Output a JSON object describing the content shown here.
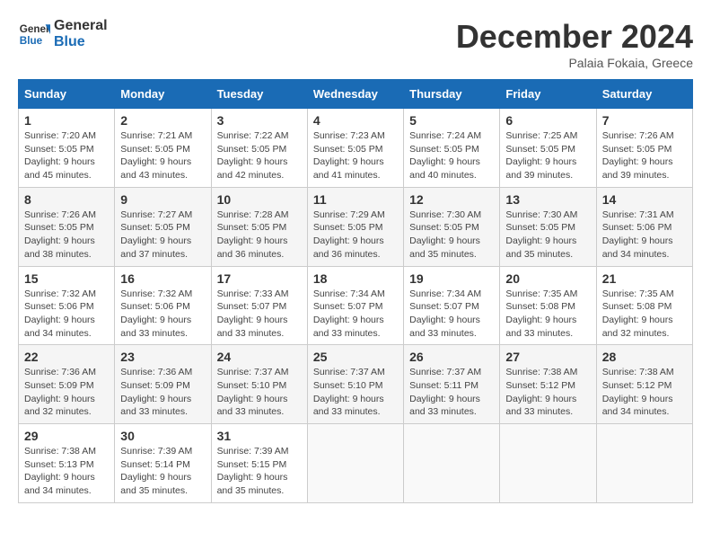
{
  "header": {
    "logo_line1": "General",
    "logo_line2": "Blue",
    "month_title": "December 2024",
    "subtitle": "Palaia Fokaia, Greece"
  },
  "weekdays": [
    "Sunday",
    "Monday",
    "Tuesday",
    "Wednesday",
    "Thursday",
    "Friday",
    "Saturday"
  ],
  "weeks": [
    [
      {
        "day": "1",
        "sunrise": "7:20 AM",
        "sunset": "5:05 PM",
        "daylight": "9 hours and 45 minutes."
      },
      {
        "day": "2",
        "sunrise": "7:21 AM",
        "sunset": "5:05 PM",
        "daylight": "9 hours and 43 minutes."
      },
      {
        "day": "3",
        "sunrise": "7:22 AM",
        "sunset": "5:05 PM",
        "daylight": "9 hours and 42 minutes."
      },
      {
        "day": "4",
        "sunrise": "7:23 AM",
        "sunset": "5:05 PM",
        "daylight": "9 hours and 41 minutes."
      },
      {
        "day": "5",
        "sunrise": "7:24 AM",
        "sunset": "5:05 PM",
        "daylight": "9 hours and 40 minutes."
      },
      {
        "day": "6",
        "sunrise": "7:25 AM",
        "sunset": "5:05 PM",
        "daylight": "9 hours and 39 minutes."
      },
      {
        "day": "7",
        "sunrise": "7:26 AM",
        "sunset": "5:05 PM",
        "daylight": "9 hours and 39 minutes."
      }
    ],
    [
      {
        "day": "8",
        "sunrise": "7:26 AM",
        "sunset": "5:05 PM",
        "daylight": "9 hours and 38 minutes."
      },
      {
        "day": "9",
        "sunrise": "7:27 AM",
        "sunset": "5:05 PM",
        "daylight": "9 hours and 37 minutes."
      },
      {
        "day": "10",
        "sunrise": "7:28 AM",
        "sunset": "5:05 PM",
        "daylight": "9 hours and 36 minutes."
      },
      {
        "day": "11",
        "sunrise": "7:29 AM",
        "sunset": "5:05 PM",
        "daylight": "9 hours and 36 minutes."
      },
      {
        "day": "12",
        "sunrise": "7:30 AM",
        "sunset": "5:05 PM",
        "daylight": "9 hours and 35 minutes."
      },
      {
        "day": "13",
        "sunrise": "7:30 AM",
        "sunset": "5:05 PM",
        "daylight": "9 hours and 35 minutes."
      },
      {
        "day": "14",
        "sunrise": "7:31 AM",
        "sunset": "5:06 PM",
        "daylight": "9 hours and 34 minutes."
      }
    ],
    [
      {
        "day": "15",
        "sunrise": "7:32 AM",
        "sunset": "5:06 PM",
        "daylight": "9 hours and 34 minutes."
      },
      {
        "day": "16",
        "sunrise": "7:32 AM",
        "sunset": "5:06 PM",
        "daylight": "9 hours and 33 minutes."
      },
      {
        "day": "17",
        "sunrise": "7:33 AM",
        "sunset": "5:07 PM",
        "daylight": "9 hours and 33 minutes."
      },
      {
        "day": "18",
        "sunrise": "7:34 AM",
        "sunset": "5:07 PM",
        "daylight": "9 hours and 33 minutes."
      },
      {
        "day": "19",
        "sunrise": "7:34 AM",
        "sunset": "5:07 PM",
        "daylight": "9 hours and 33 minutes."
      },
      {
        "day": "20",
        "sunrise": "7:35 AM",
        "sunset": "5:08 PM",
        "daylight": "9 hours and 33 minutes."
      },
      {
        "day": "21",
        "sunrise": "7:35 AM",
        "sunset": "5:08 PM",
        "daylight": "9 hours and 32 minutes."
      }
    ],
    [
      {
        "day": "22",
        "sunrise": "7:36 AM",
        "sunset": "5:09 PM",
        "daylight": "9 hours and 32 minutes."
      },
      {
        "day": "23",
        "sunrise": "7:36 AM",
        "sunset": "5:09 PM",
        "daylight": "9 hours and 33 minutes."
      },
      {
        "day": "24",
        "sunrise": "7:37 AM",
        "sunset": "5:10 PM",
        "daylight": "9 hours and 33 minutes."
      },
      {
        "day": "25",
        "sunrise": "7:37 AM",
        "sunset": "5:10 PM",
        "daylight": "9 hours and 33 minutes."
      },
      {
        "day": "26",
        "sunrise": "7:37 AM",
        "sunset": "5:11 PM",
        "daylight": "9 hours and 33 minutes."
      },
      {
        "day": "27",
        "sunrise": "7:38 AM",
        "sunset": "5:12 PM",
        "daylight": "9 hours and 33 minutes."
      },
      {
        "day": "28",
        "sunrise": "7:38 AM",
        "sunset": "5:12 PM",
        "daylight": "9 hours and 34 minutes."
      }
    ],
    [
      {
        "day": "29",
        "sunrise": "7:38 AM",
        "sunset": "5:13 PM",
        "daylight": "9 hours and 34 minutes."
      },
      {
        "day": "30",
        "sunrise": "7:39 AM",
        "sunset": "5:14 PM",
        "daylight": "9 hours and 35 minutes."
      },
      {
        "day": "31",
        "sunrise": "7:39 AM",
        "sunset": "5:15 PM",
        "daylight": "9 hours and 35 minutes."
      },
      null,
      null,
      null,
      null
    ]
  ],
  "labels": {
    "sunrise": "Sunrise:",
    "sunset": "Sunset:",
    "daylight": "Daylight:"
  }
}
